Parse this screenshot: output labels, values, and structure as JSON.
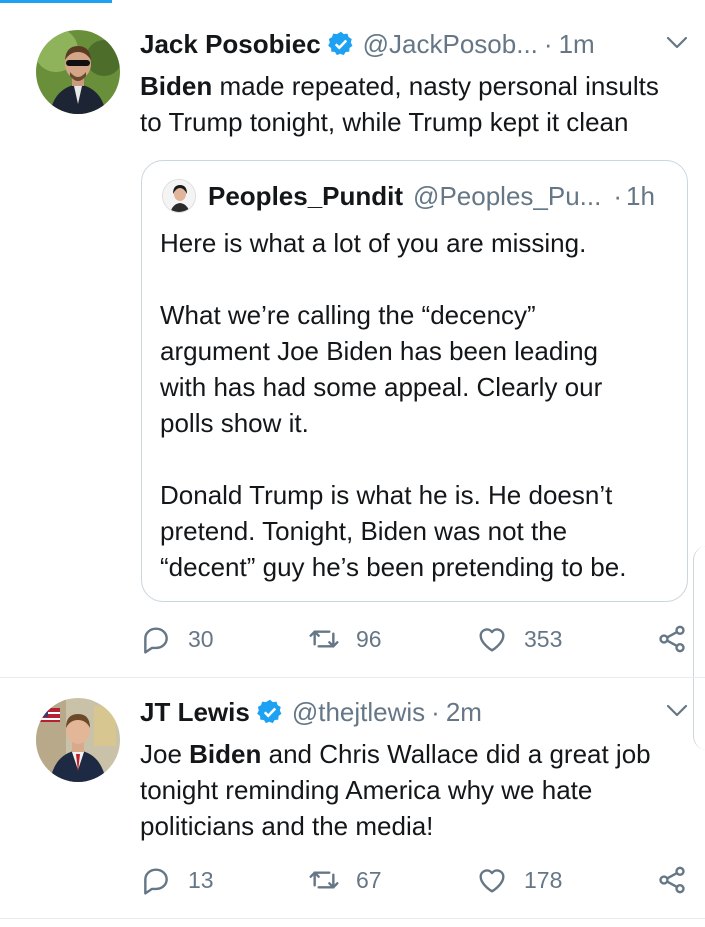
{
  "tweets": [
    {
      "name": "Jack Posobiec",
      "handle": "@JackPosob...",
      "sep": "·",
      "time": "1m",
      "text_lines": [
        {
          "bold": "Biden",
          "rest": " made repeated, nasty personal insults"
        },
        {
          "bold": "",
          "rest": "to Trump tonight, while Trump kept it clean"
        }
      ],
      "quote": {
        "name": "Peoples_Pundit",
        "handle": "@Peoples_Pu...",
        "sep": "·",
        "time": "1h",
        "lines": [
          "Here is what a lot of you are missing.",
          "What we’re calling the “decency”",
          "argument Joe Biden has been leading",
          "with has had some appeal. Clearly our",
          "polls show it.",
          "Donald Trump is what he is. He doesn’t",
          "pretend. Tonight, Biden was not the",
          "“decent” guy he’s been pretending to be."
        ]
      },
      "replies": "30",
      "retweets": "96",
      "likes": "353"
    },
    {
      "name": "JT Lewis",
      "handle": "@thejtlewis",
      "sep": "·",
      "time": "2m",
      "text_lines": [
        {
          "pre": "Joe ",
          "bold": "Biden",
          "rest": " and Chris Wallace did a great job"
        },
        {
          "pre": "",
          "bold": "",
          "rest": "tonight reminding America why we hate"
        },
        {
          "pre": "",
          "bold": "",
          "rest": "politicians and the media!"
        }
      ],
      "replies": "13",
      "retweets": "67",
      "likes": "178"
    }
  ],
  "icons": [
    "verified-badge-icon",
    "chevron-down-icon",
    "reply-icon",
    "retweet-icon",
    "like-icon",
    "share-icon"
  ],
  "colors": {
    "accent": "#1da1f2",
    "muted": "#657786",
    "text": "#14171a",
    "border": "#ccd6dd"
  }
}
